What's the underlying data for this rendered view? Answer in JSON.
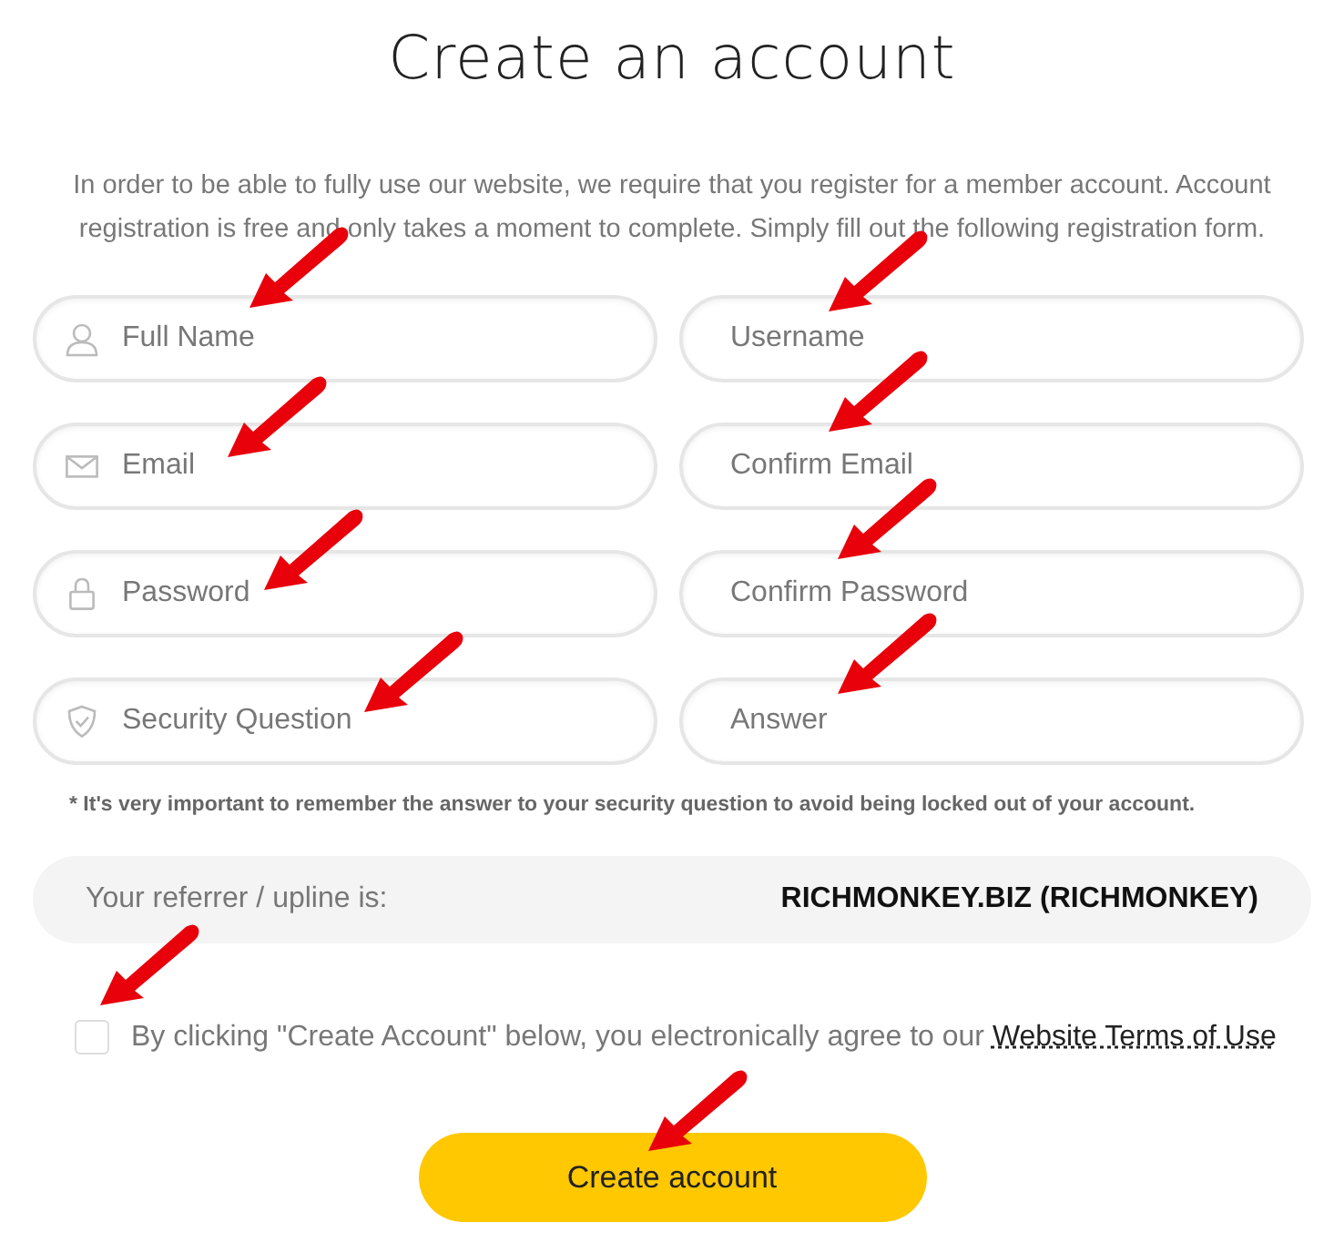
{
  "title": "Create an account",
  "intro": "In order to be able to fully use our website, we require that you register for a member account. Account registration is free and only takes a moment to complete. Simply fill out the following registration form.",
  "fields": [
    {
      "placeholder": "Full Name",
      "has_icon": true,
      "marked": true
    },
    {
      "placeholder": "Username",
      "has_icon": false,
      "marked": true
    },
    {
      "placeholder": "Email",
      "has_icon": true,
      "marked": true
    },
    {
      "placeholder": "Confirm Email",
      "has_icon": false,
      "marked": true
    },
    {
      "placeholder": "Password",
      "has_icon": true,
      "marked": true
    },
    {
      "placeholder": "Confirm Password",
      "has_icon": false,
      "marked": true
    },
    {
      "placeholder": "Security Question",
      "has_icon": true,
      "marked": true
    },
    {
      "placeholder": "Answer",
      "has_icon": false,
      "marked": true
    }
  ],
  "note": "* It's very important to remember the answer to your security question to avoid being locked out of your account.",
  "referrer": {
    "label": "Your referrer / upline is:",
    "value": "RICHMONKEY.BIZ (RICHMONKEY)"
  },
  "agreement": {
    "checked": false,
    "marked": true,
    "text": "By clicking \"Create Account\" below, you electronically agree to our",
    "link": "Website Terms of Use"
  },
  "submit": {
    "label": "Create account",
    "marked": true
  }
}
